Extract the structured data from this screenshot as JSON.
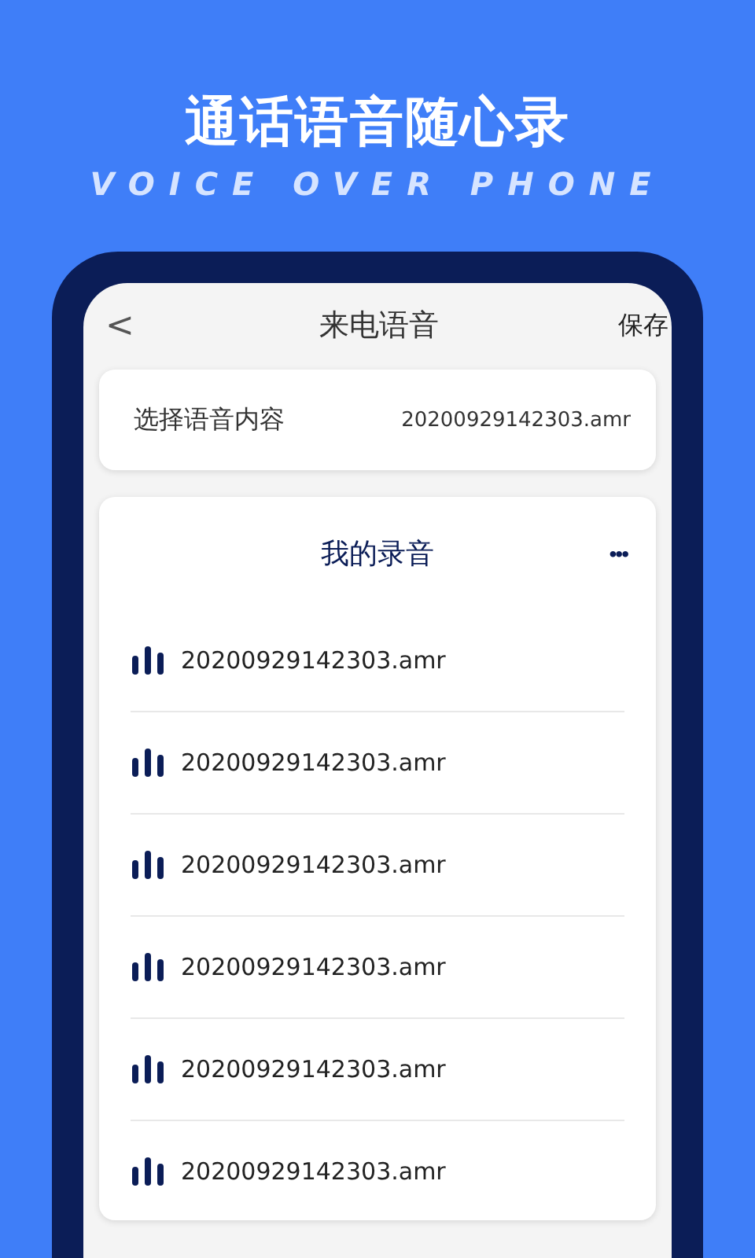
{
  "promo": {
    "title": "通话语音随心录",
    "subtitle": "VOICE OVER PHONE"
  },
  "header": {
    "back": "<",
    "title": "来电语音",
    "save": "保存"
  },
  "selection": {
    "label": "选择语音内容",
    "value": "20200929142303.amr"
  },
  "recordings": {
    "title": "我的录音",
    "more": "•••",
    "items": [
      {
        "name": "20200929142303.amr"
      },
      {
        "name": "20200929142303.amr"
      },
      {
        "name": "20200929142303.amr"
      },
      {
        "name": "20200929142303.amr"
      },
      {
        "name": "20200929142303.amr"
      },
      {
        "name": "20200929142303.amr"
      }
    ]
  }
}
